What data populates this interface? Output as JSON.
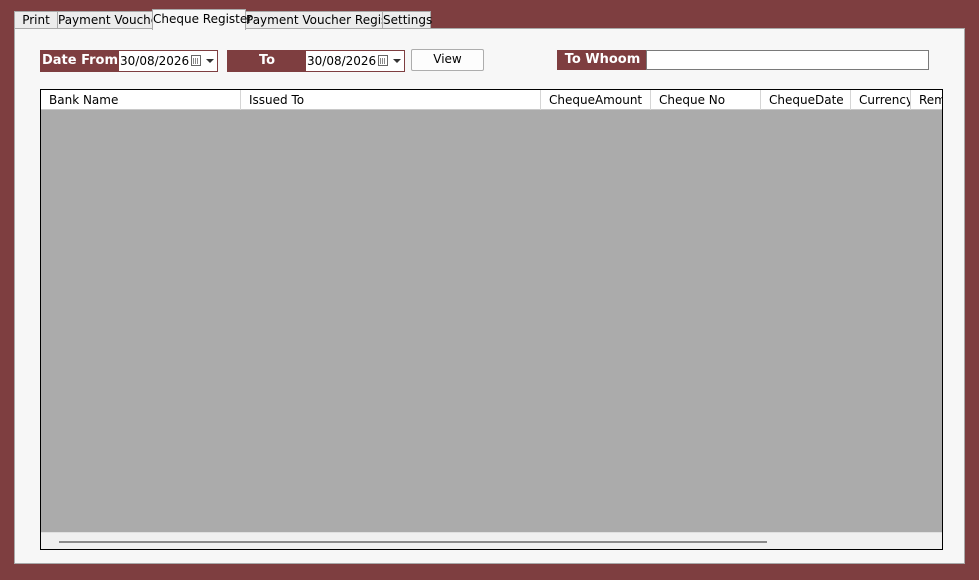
{
  "tabs": [
    {
      "label": "Print"
    },
    {
      "label": "Payment Voucher"
    },
    {
      "label": "Cheque Register"
    },
    {
      "label": "Payment Voucher Register"
    },
    {
      "label": "Settings"
    }
  ],
  "filters": {
    "date_from_label": "Date From",
    "date_from_value": "30/08/2026",
    "to_label": "To",
    "to_value": "30/08/2026",
    "view_button": "View",
    "to_whoom_label": "To Whoom",
    "to_whoom_value": ""
  },
  "grid": {
    "columns": [
      "Bank Name",
      "Issued To",
      "ChequeAmount",
      "Cheque No",
      "ChequeDate",
      "Currency",
      "Remarks"
    ],
    "rows": []
  },
  "colors": {
    "accent": "#7e3e40",
    "grid_background": "#ababab",
    "panel_background": "#f7f7f7"
  }
}
